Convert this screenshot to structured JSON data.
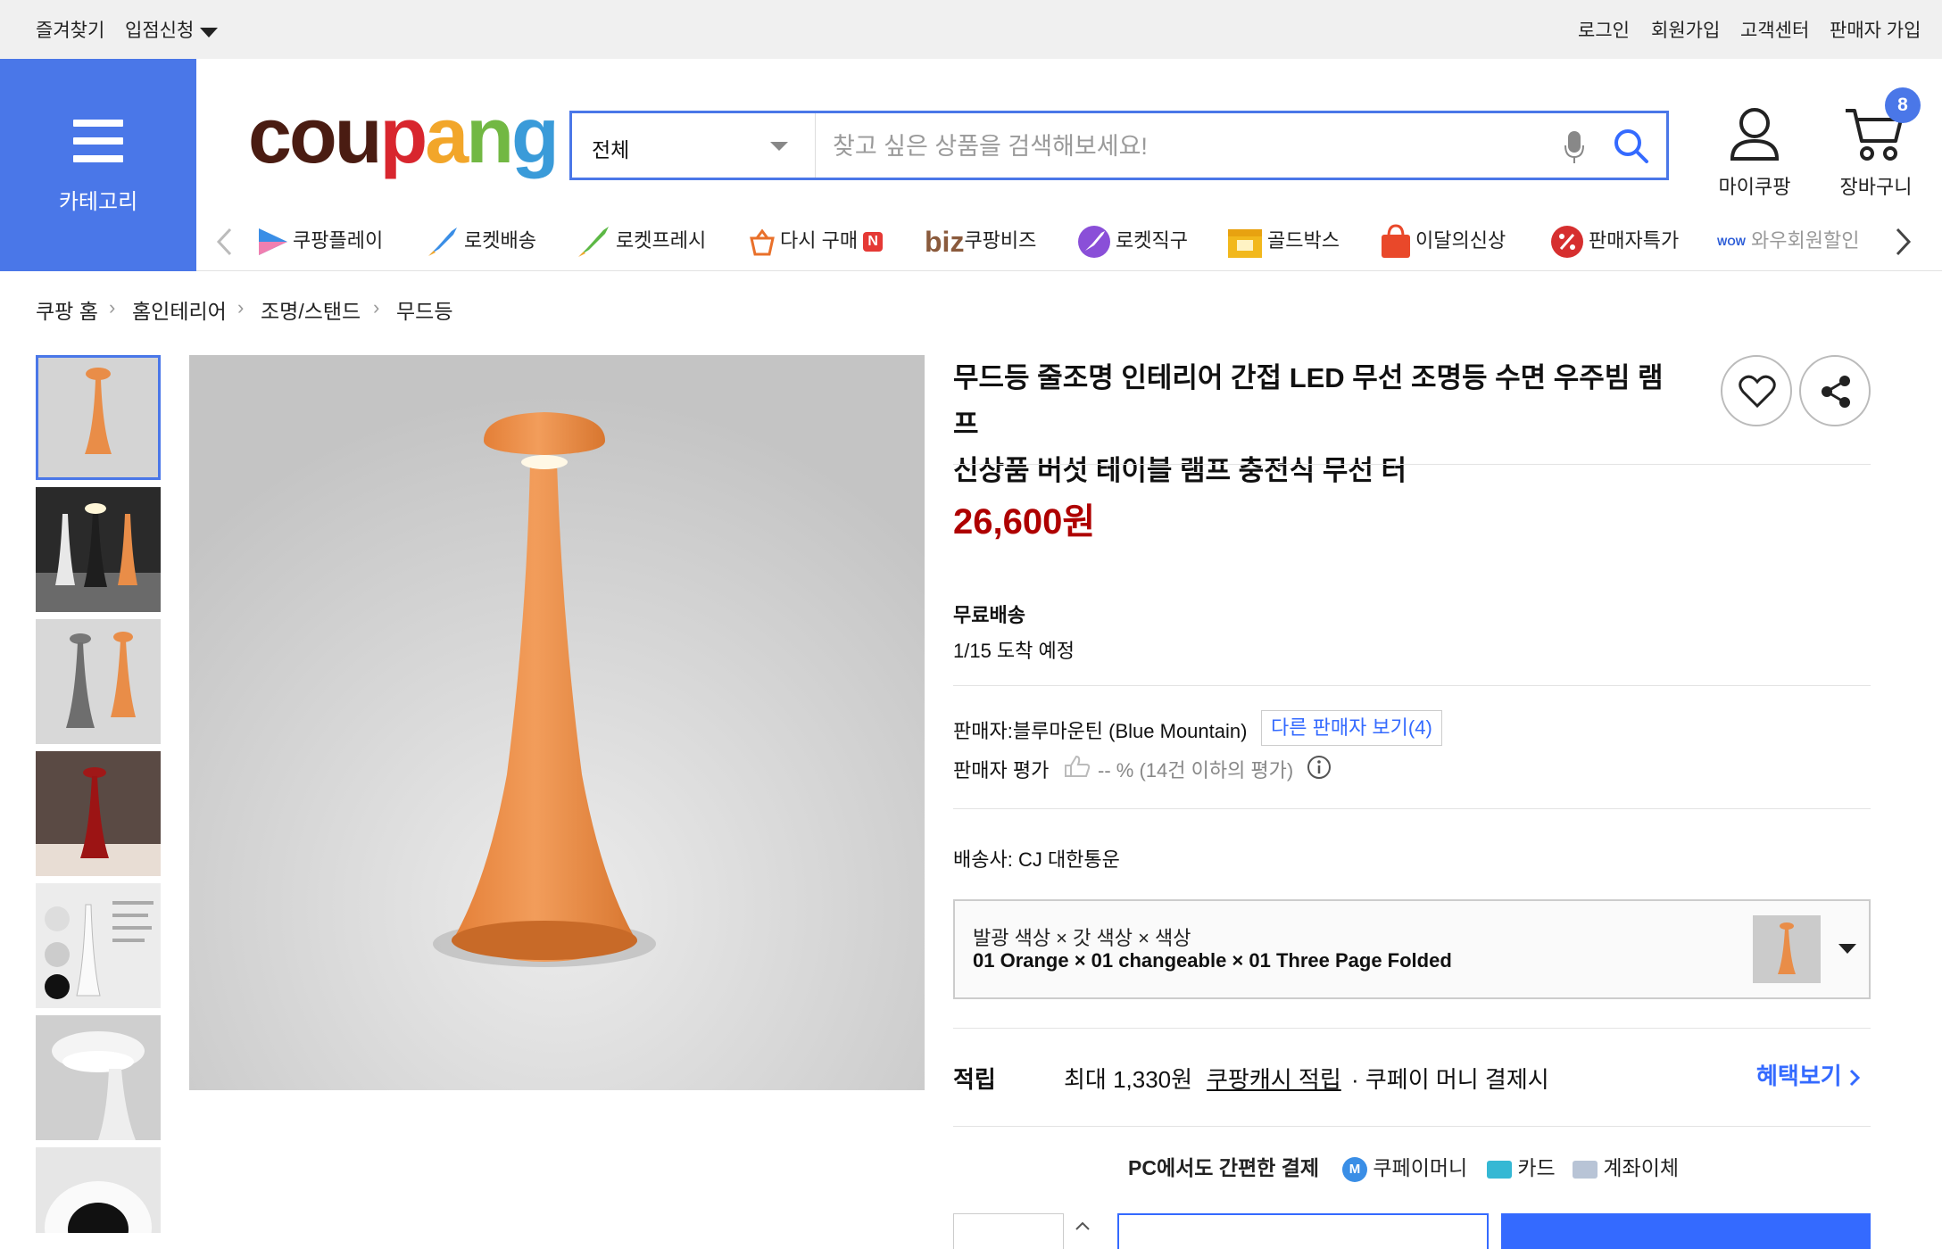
{
  "topbar": {
    "left": [
      "즐겨찾기",
      "입점신청"
    ],
    "right": [
      "로그인",
      "회원가입",
      "고객센터",
      "판매자 가입"
    ]
  },
  "category": {
    "label": "카테고리"
  },
  "logo": {
    "text": "coupang",
    "letters": [
      "c",
      "o",
      "u",
      "p",
      "a",
      "n",
      "g"
    ],
    "letter_colors": [
      "#4a1c12",
      "#4a1c12",
      "#4a1c12",
      "#d8262e",
      "#f2a62a",
      "#72b843",
      "#3a9bd9"
    ]
  },
  "search": {
    "scope": "전체",
    "placeholder": "찾고 싶은 상품을 검색해보세요!",
    "value": ""
  },
  "header_icons": {
    "mycoupang": "마이쿠팡",
    "cart": "장바구니",
    "cart_count": "8"
  },
  "services": [
    "쿠팡플레이",
    "로켓배송",
    "로켓프레시",
    "다시 구매",
    "쿠팡비즈",
    "로켓직구",
    "골드박스",
    "이달의신상",
    "판매자특가",
    "와우회원할인"
  ],
  "services_extra": {
    "biz_prefix": "biz",
    "new_badge": "N",
    "wow_label": "WOW"
  },
  "breadcrumb": [
    "쿠팡 홈",
    "홈인테리어",
    "조명/스탠드",
    "무드등"
  ],
  "product": {
    "title_line1": "무드등 줄조명 인테리어 간접 LED 무선 조명등 수면 우주빔 램프",
    "title_line2": "신상품 버섯 테이블 램프 충전식 무선 터",
    "price": "26,600원",
    "shipping_label": "무료배송",
    "arrival": "1/15 도착 예정",
    "seller": "판매자:블루마운틴 (Blue Mountain)",
    "other_sellers": "다른 판매자 보기(4)",
    "seller_rating_label": "판매자 평가",
    "seller_rating_value": "-- % (14건 이하의 평가)",
    "carrier": "배송사:  CJ 대한통운",
    "option_header": "발광 색상 × 갓 색상 × 색상",
    "option_value": "01 Orange × 01 changeable × 01 Three Page Folded",
    "points_label": "적립",
    "points_max": "최대 1,330원",
    "points_cash": "쿠팡캐시 적립",
    "points_note": "· 쿠페이 머니 결제시",
    "benefit_link": "혜택보기",
    "pay_label": "PC에서도 간편한 결제",
    "pay_methods": [
      "쿠페이머니",
      "카드",
      "계좌이체"
    ]
  },
  "colors": {
    "accent": "#4a77e8",
    "price": "#ae0000",
    "link": "#346aff",
    "lamp": "#e98d48"
  }
}
